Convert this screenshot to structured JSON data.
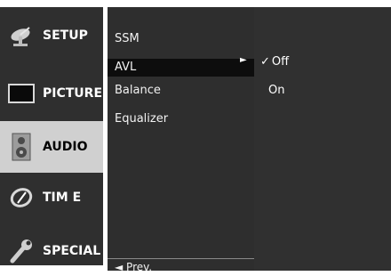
{
  "sidebar": {
    "items": [
      {
        "label": "SETUP",
        "icon": "satellite-dish-icon"
      },
      {
        "label": "PICTURE",
        "icon": "tv-screen-icon"
      },
      {
        "label": "AUDIO",
        "icon": "speaker-icon"
      },
      {
        "label": "TIM E",
        "icon": "clock-icon"
      },
      {
        "label": "SPECIAL",
        "icon": "wrench-icon"
      }
    ],
    "selected": "AUDIO"
  },
  "menu": {
    "items": [
      {
        "label": "SSM"
      },
      {
        "label": "AVL"
      },
      {
        "label": "Balance"
      },
      {
        "label": "Equalizer"
      }
    ],
    "selected": "AVL",
    "prev_label": "◄ Prev."
  },
  "submenu": {
    "options": [
      {
        "label": "Off",
        "checked": true
      },
      {
        "label": "On",
        "checked": false
      }
    ],
    "arrow": "►",
    "check_mark": "✓"
  },
  "colors": {
    "panel_bg": "#2f2f2f",
    "selected_category_bg": "#d0d0d0",
    "selected_menu_bg": "#0d0d0d"
  }
}
